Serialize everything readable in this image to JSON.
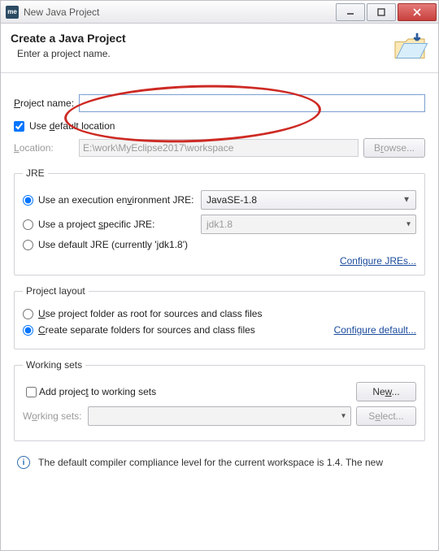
{
  "window": {
    "title": "New Java Project",
    "app_icon_text": "me"
  },
  "header": {
    "title": "Create a Java Project",
    "subtitle": "Enter a project name."
  },
  "project_name": {
    "label_pre": "P",
    "label_post": "roject name:",
    "value": ""
  },
  "default_location": {
    "label_pre": "Use ",
    "label_u": "d",
    "label_post": "efault location",
    "checked": true
  },
  "location": {
    "label_post": "ocation:",
    "value": "E:\\work\\MyEclipse2017\\workspace",
    "browse_pre": "B",
    "browse_u": "r",
    "browse_post": "owse..."
  },
  "jre": {
    "legend": "JRE",
    "opt_env_pre": "Use an execution en",
    "opt_env_u": "v",
    "opt_env_post": "ironment JRE:",
    "env_value": "JavaSE-1.8",
    "opt_proj_pre": "Use a project ",
    "opt_proj_u": "s",
    "opt_proj_post": "pecific JRE:",
    "proj_value": "jdk1.8",
    "opt_default": "Use default JRE (currently 'jdk1.8')",
    "configure_link": "Configure JREs..."
  },
  "layout": {
    "legend": "Project layout",
    "root_pre": "U",
    "root_post": "se project folder as root for sources and class files",
    "sep_pre": "C",
    "sep_post": "reate separate folders for sources and class files",
    "configure_link": "Configure default..."
  },
  "working_sets": {
    "legend": "Working sets",
    "add_pre": "Add projec",
    "add_u": "t",
    "add_post": " to working sets",
    "new_btn_pre": "Ne",
    "new_btn_u": "w",
    "new_btn_post": "...",
    "label_pre": "W",
    "label_u": "o",
    "label_post": "rking sets:",
    "select_btn_pre": "S",
    "select_btn_u": "e",
    "select_btn_post": "lect..."
  },
  "info": {
    "text": "The default compiler compliance level for the current workspace is 1.4. The new"
  }
}
